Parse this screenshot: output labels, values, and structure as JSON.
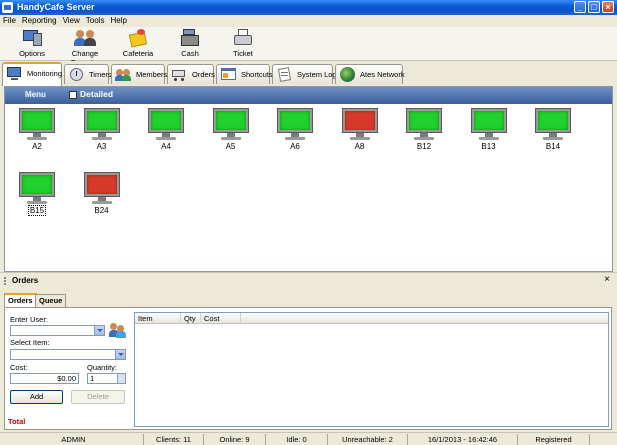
{
  "window": {
    "title": "HandyCafe Server",
    "buttons": [
      "minimize",
      "maximize",
      "close"
    ]
  },
  "menubar": {
    "items": [
      "File",
      "Reporting",
      "View",
      "Tools",
      "Help"
    ]
  },
  "toolbar": {
    "items": [
      {
        "label": "Options",
        "icon": "options-computer-icon"
      },
      {
        "label": "Change Operator",
        "icon": "users-icon"
      },
      {
        "label": "Cafeteria",
        "icon": "cafeteria-icon"
      },
      {
        "label": "Cash",
        "icon": "cash-register-icon"
      },
      {
        "label": "Ticket",
        "icon": "ticket-printer-icon"
      }
    ]
  },
  "tabs": [
    {
      "label": "Monitoring",
      "icon": "monitor-icon",
      "active": true
    },
    {
      "label": "Timers",
      "icon": "clock-icon"
    },
    {
      "label": "Members",
      "icon": "members-icon"
    },
    {
      "label": "Orders",
      "icon": "cart-icon"
    },
    {
      "label": "Shortcuts",
      "icon": "shortcuts-icon"
    },
    {
      "label": "System Log",
      "icon": "log-icon"
    },
    {
      "label": "Ates Network",
      "icon": "globe-icon"
    }
  ],
  "monitoring": {
    "menu_label": "Menu",
    "detailed_label": "Detailed",
    "detailed_checked": false,
    "computers": [
      {
        "name": "A2",
        "status": "online"
      },
      {
        "name": "A3",
        "status": "online"
      },
      {
        "name": "A4",
        "status": "online"
      },
      {
        "name": "A5",
        "status": "online"
      },
      {
        "name": "A6",
        "status": "online"
      },
      {
        "name": "A8",
        "status": "unreachable"
      },
      {
        "name": "B12",
        "status": "online"
      },
      {
        "name": "B13",
        "status": "online"
      },
      {
        "name": "B14",
        "status": "online"
      },
      {
        "name": "B15",
        "status": "online",
        "selected": true
      },
      {
        "name": "B24",
        "status": "unreachable"
      }
    ]
  },
  "colors": {
    "online": "#1fd12a",
    "unreachable": "#d63a2a"
  },
  "orders": {
    "title": "Orders",
    "close_glyph": "×",
    "tabs": [
      {
        "label": "Orders",
        "active": true
      },
      {
        "label": "Queue"
      }
    ],
    "enter_user_label": "Enter User:",
    "enter_user_value": "",
    "select_item_label": "Select Item:",
    "select_item_value": "",
    "cost_label": "Cost:",
    "cost_value": "$0.00",
    "quantity_label": "Quantity:",
    "quantity_value": "1",
    "add_button": "Add",
    "delete_button": "Delete",
    "total_label": "Total",
    "columns": [
      "Item",
      "Qty",
      "Cost"
    ],
    "rows": []
  },
  "statusbar": {
    "user": "ADMIN",
    "clients": "Clients: 11",
    "online": "Online: 9",
    "idle": "Idle: 0",
    "unreachable": "Unreachable: 2",
    "datetime": "16/1/2013 - 16:42:46",
    "registration": "Registered"
  }
}
